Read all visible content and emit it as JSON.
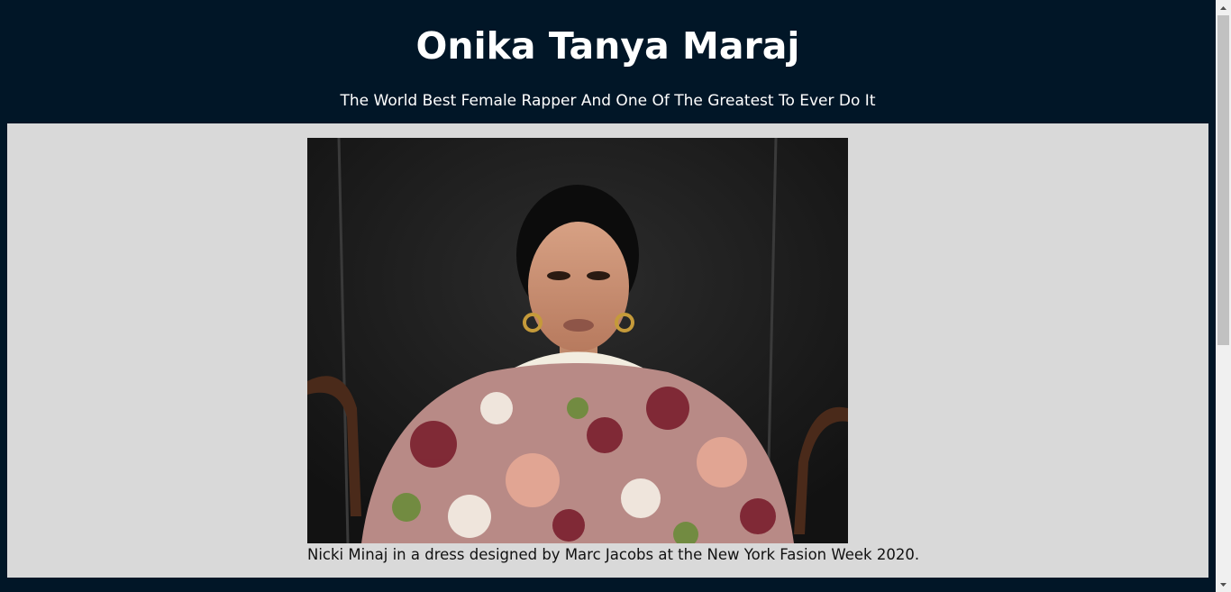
{
  "header": {
    "title": "Onika Tanya Maraj",
    "tagline": "The World Best Female Rapper And One Of The Greatest To Ever Do It"
  },
  "main": {
    "photo_alt": "Nicki Minaj in a dress designed by Marc Jacobs",
    "caption": "Nicki Minaj in a dress designed by Marc Jacobs at the New York Fasion Week 2020."
  },
  "colors": {
    "page_background": "#011627",
    "content_background": "#d9d9d9",
    "title_text": "#ffffff"
  },
  "icons": {
    "scroll_up": "triangle-up-icon",
    "scroll_down": "triangle-down-icon"
  }
}
